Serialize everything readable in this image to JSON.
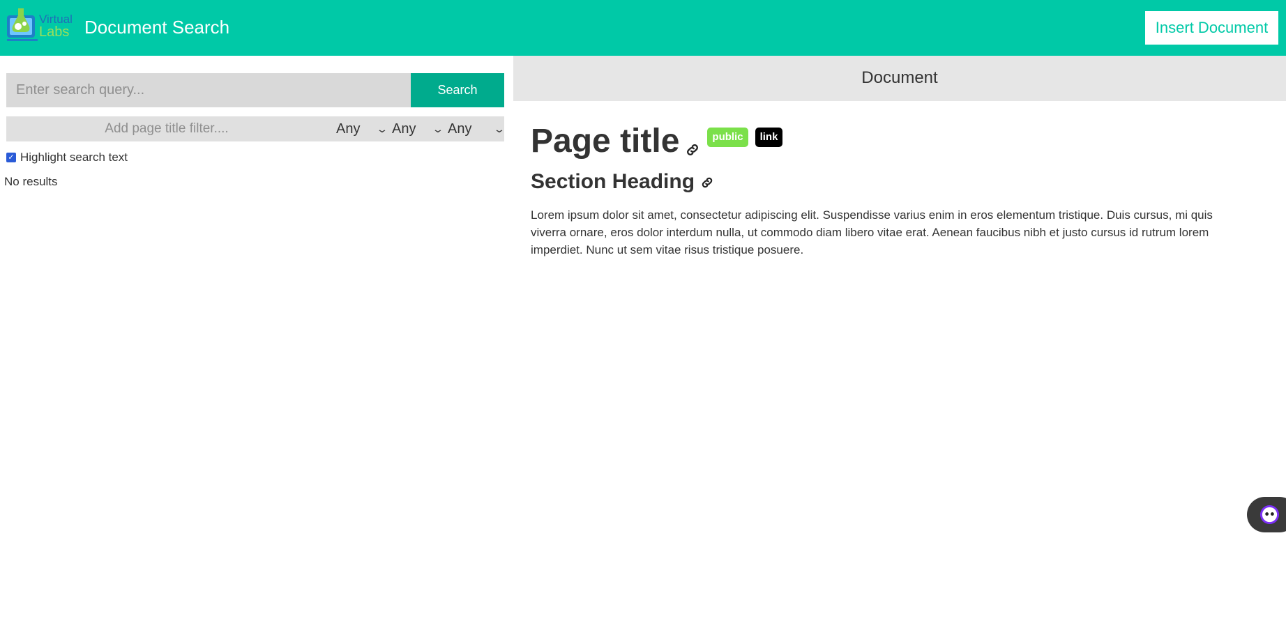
{
  "header": {
    "logo_text_top": "Virtual",
    "logo_text_bottom": "Labs",
    "title": "Document Search",
    "insert_button": "Insert Document",
    "color": "#00c9a7"
  },
  "search": {
    "placeholder": "Enter search query...",
    "button": "Search",
    "title_filter_placeholder": "Add page title filter....",
    "selects": [
      "Any",
      "Any",
      "Any"
    ],
    "highlight_label": "Highlight search text",
    "highlight_checked": true,
    "results_text": "No results"
  },
  "document": {
    "panel_header": "Document",
    "page_title": "Page title",
    "badges": {
      "public": "public",
      "link": "link"
    },
    "section_heading": "Section Heading",
    "body": "Lorem ipsum dolor sit amet, consectetur adipiscing elit. Suspendisse varius enim in eros elementum tristique. Duis cursus, mi quis viverra ornare, eros dolor interdum nulla, ut commodo diam libero vitae erat. Aenean faucibus nibh et justo cursus id rutrum lorem imperdiet. Nunc ut sem vitae risus tristique posuere."
  },
  "icons": [
    "vlabs-logo",
    "link-icon",
    "chevron-down-icon",
    "checkbox-check-icon",
    "chatbot-icon"
  ]
}
